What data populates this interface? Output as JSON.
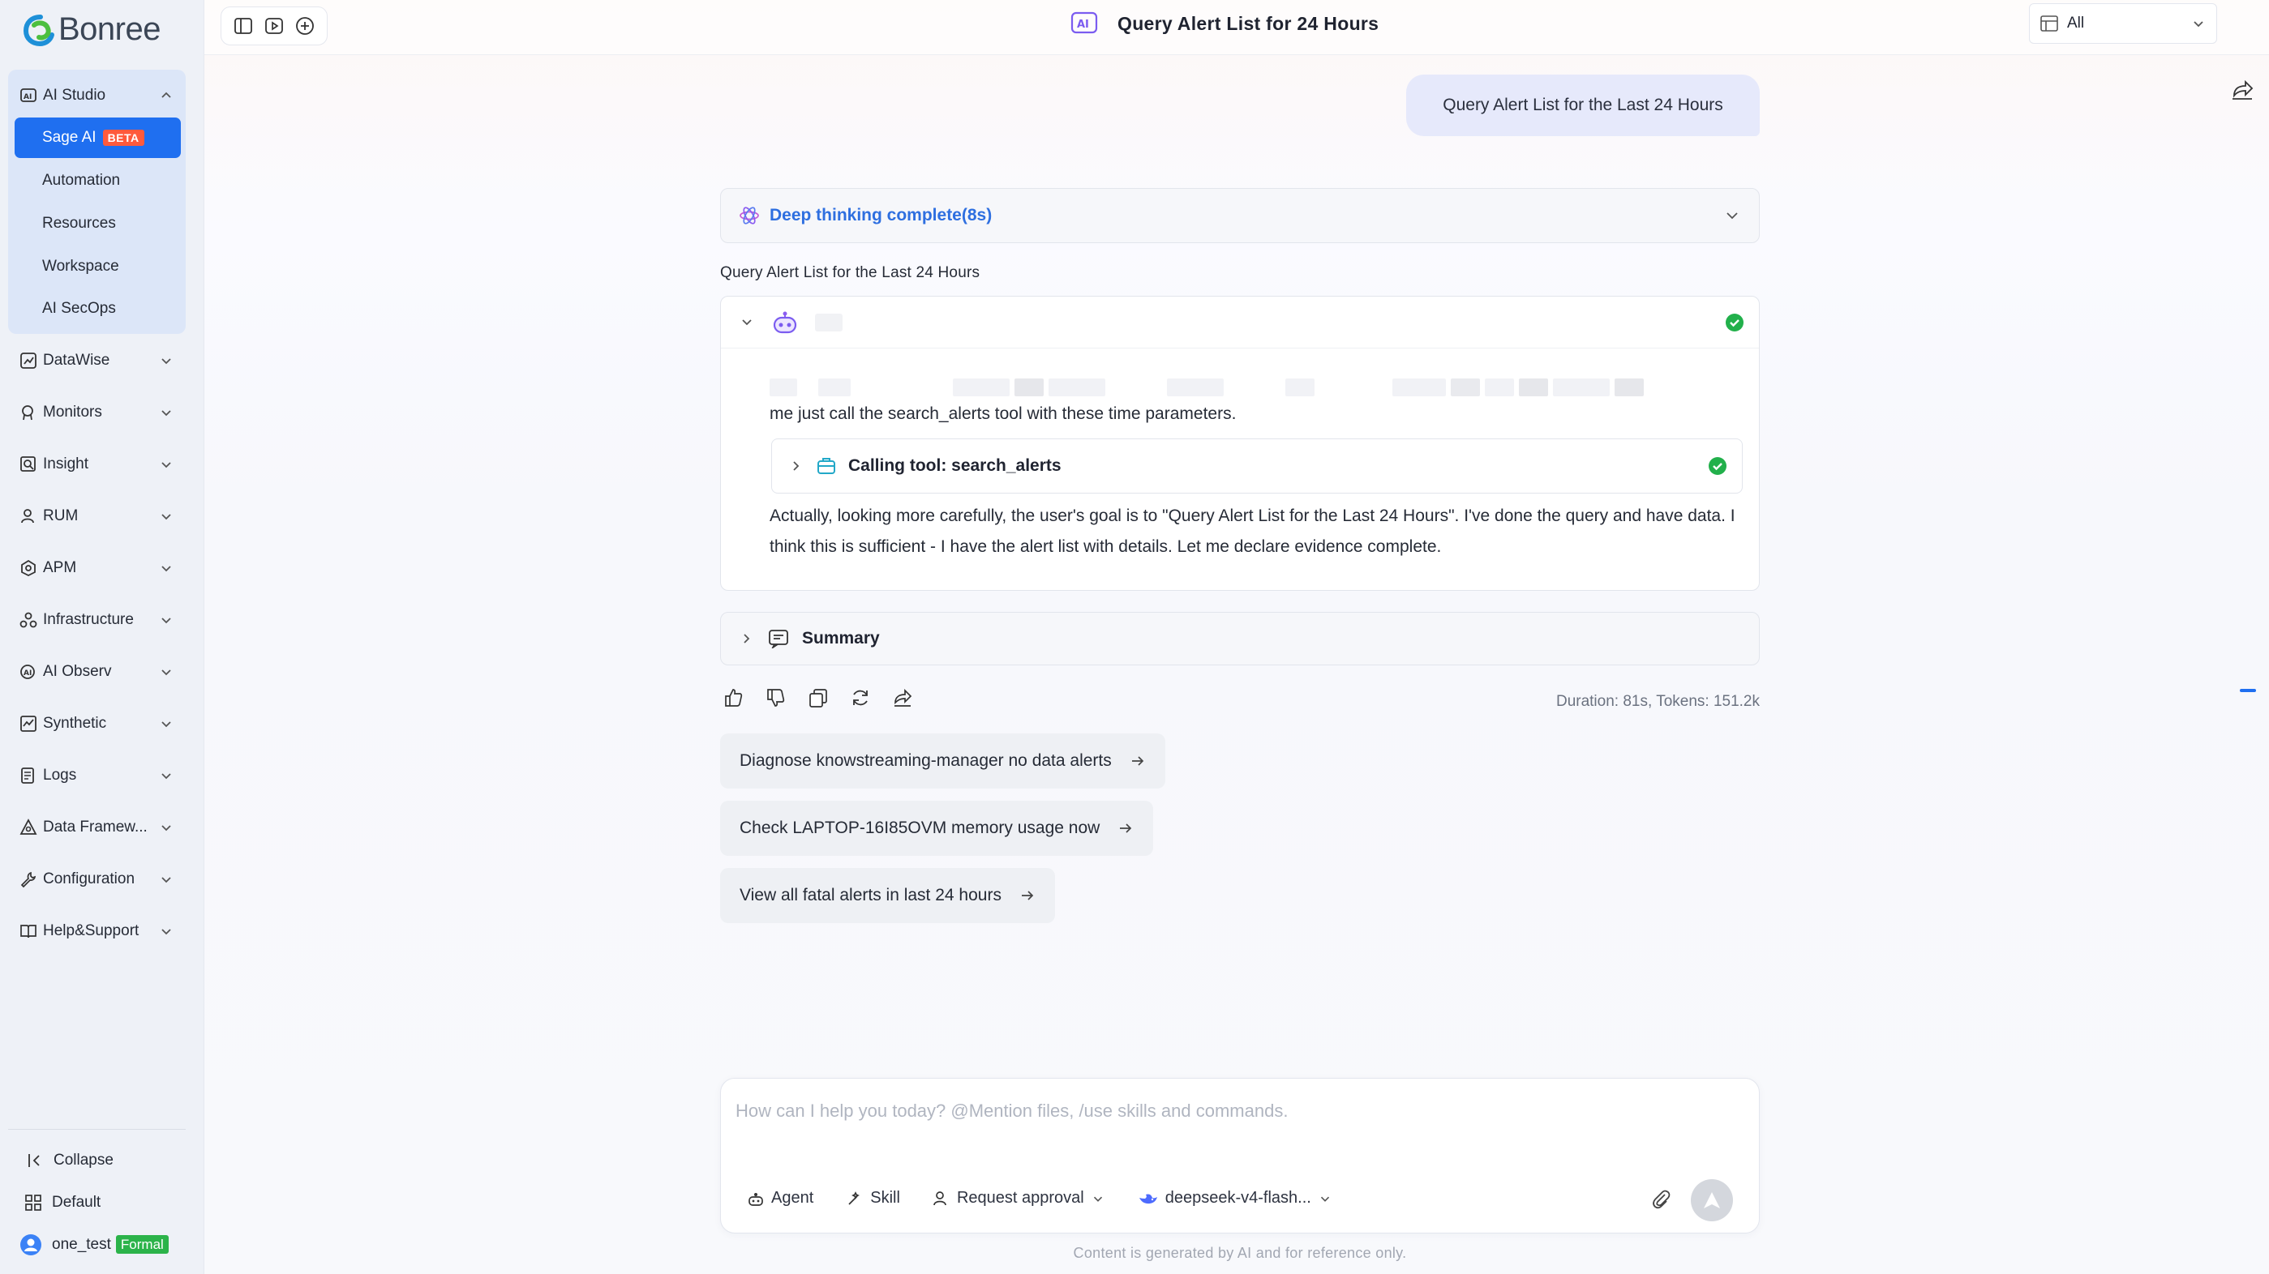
{
  "app": {
    "logo_text": "Bonree"
  },
  "sidebar": {
    "ai_studio": {
      "label": "AI Studio",
      "items": [
        {
          "label": "Sage AI",
          "badge": "BETA",
          "active": true
        },
        {
          "label": "Automation"
        },
        {
          "label": "Resources"
        },
        {
          "label": "Workspace"
        },
        {
          "label": "AI SecOps"
        }
      ]
    },
    "groups": [
      {
        "label": "DataWise",
        "icon": "chart-icon"
      },
      {
        "label": "Monitors",
        "icon": "monitor-pin-icon"
      },
      {
        "label": "Insight",
        "icon": "insight-icon"
      },
      {
        "label": "RUM",
        "icon": "user-icon"
      },
      {
        "label": "APM",
        "icon": "apm-icon"
      },
      {
        "label": "Infrastructure",
        "icon": "infrastructure-icon"
      },
      {
        "label": "AI Observ",
        "icon": "ai-observ-icon"
      },
      {
        "label": "Synthetic",
        "icon": "synthetic-icon"
      },
      {
        "label": "Logs",
        "icon": "logs-icon"
      },
      {
        "label": "Data Framew...",
        "icon": "data-framework-icon"
      },
      {
        "label": "Configuration",
        "icon": "wrench-icon"
      },
      {
        "label": "Help&Support",
        "icon": "book-icon"
      }
    ],
    "collapse_label": "Collapse",
    "default_label": "Default",
    "user": {
      "name": "one_test",
      "badge": "Formal"
    }
  },
  "topbar": {
    "title": "Query Alert List for 24 Hours",
    "scope_value": "All"
  },
  "conversation": {
    "user_message": "Query Alert List for the Last 24 Hours",
    "thinking_label": "Deep thinking complete(8s)",
    "answer_heading": "Query Alert List for the Last 24 Hours",
    "agent_text_partial": "me just call the search_alerts tool with these time parameters.",
    "tool_call_label": "Calling tool: search_alerts",
    "agent_paragraph": "Actually, looking more carefully, the user's goal is to \"Query Alert List for the Last 24 Hours\". I've done the query and have data. I think this is sufficient - I have the alert list with details. Let me declare evidence complete.",
    "summary_label": "Summary",
    "meta": "Duration: 81s, Tokens: 151.2k",
    "suggestions": [
      "Diagnose knowstreaming-manager no data alerts",
      "Check LAPTOP-16I85OVM memory usage now",
      "View all fatal alerts in last 24 hours"
    ]
  },
  "composer": {
    "placeholder": "How can I help you today? @Mention files, /use skills and commands.",
    "agent_label": "Agent",
    "skill_label": "Skill",
    "approval_label": "Request approval",
    "model_label": "deepseek-v4-flash...",
    "disclaimer": "Content is generated by AI and for reference only."
  },
  "colors": {
    "accent": "#1f6ff0",
    "thinking_text": "#2e6fe0",
    "beta_badge": "#ff5a3c",
    "formal_badge": "#2bb34a",
    "success": "#22b04b"
  }
}
